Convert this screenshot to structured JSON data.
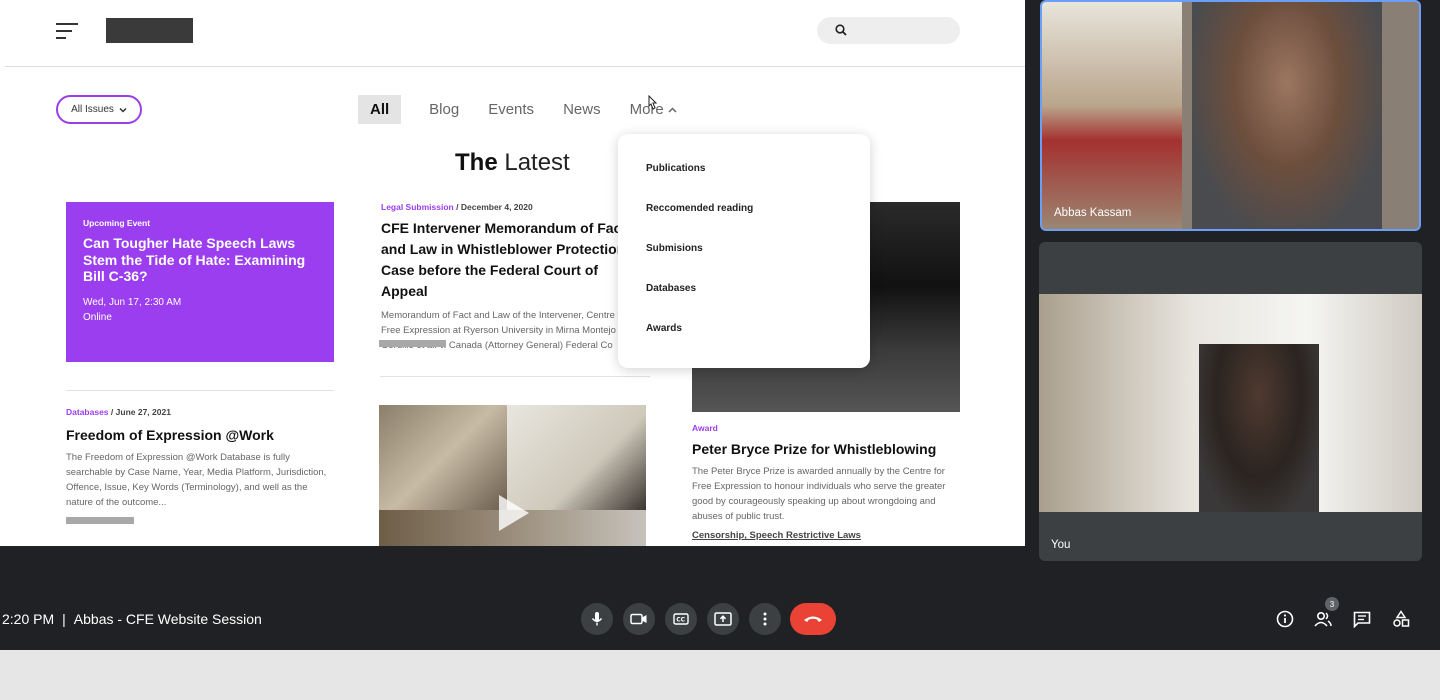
{
  "site": {
    "filter_label": "All Issues",
    "tabs": [
      "All",
      "Blog",
      "Events",
      "News",
      "More"
    ],
    "heading_bold": "The",
    "heading_rest": "Latest",
    "dropdown_items": [
      "Publications",
      "Reccomended reading",
      "Submisions",
      "Databases",
      "Awards"
    ],
    "event_card": {
      "tag": "Upcoming  Event",
      "title": "Can Tougher Hate Speech Laws Stem the Tide of Hate: Examining Bill C-36?",
      "date": "Wed, Jun 17, 2:30 AM",
      "location": "Online"
    },
    "article_db": {
      "category": "Databases",
      "date": "June 27, 2021",
      "title": "Freedom of Expression @Work",
      "desc": "The Freedom of Expression @Work Database is fully searchable by Case Name, Year, Media Platform, Jurisdiction, Offence, Issue, Key Words (Terminology), and well as the nature of the outcome..."
    },
    "article_legal": {
      "category": "Legal Submission",
      "date": "December 4, 2020",
      "title": "CFE Intervener Memorandum of Fact and Law in Whistleblower Protection Case before the Federal Court of Appeal",
      "desc": "Memorandum of Fact and Law of the Intervener, Centre for Free Expression at Ryerson University in Mirna Montejo Gordillo et al. v. Canada (Attorney General) Federal Co"
    },
    "article_award": {
      "category": "Award",
      "title": "Peter Bryce Prize for Whistleblowing",
      "desc": "The Peter Bryce Prize is awarded annually by the Centre for Free Expression to honour individuals who serve the greater good by courageously speaking up about wrongdoing and abuses of public trust.",
      "tags": "Censorship, Speech Restrictive Laws"
    },
    "meta_sep": "/"
  },
  "participants": [
    {
      "name": "Abbas Kassam"
    },
    {
      "name": "You"
    }
  ],
  "meeting": {
    "time": "2:20 PM",
    "separator": "|",
    "title": "Abbas - CFE Website Session",
    "participant_count": "3"
  },
  "colors": {
    "accent": "#9b3eef",
    "meet_bg": "#202124",
    "end_call": "#ea4335"
  },
  "icons": [
    "menu-icon",
    "search-icon",
    "chevron-down-icon",
    "chevron-up-icon",
    "cursor-icon",
    "play-icon",
    "mic-icon",
    "camera-icon",
    "captions-icon",
    "present-icon",
    "more-icon",
    "end-call-icon",
    "info-icon",
    "people-icon",
    "chat-icon",
    "activities-icon"
  ]
}
